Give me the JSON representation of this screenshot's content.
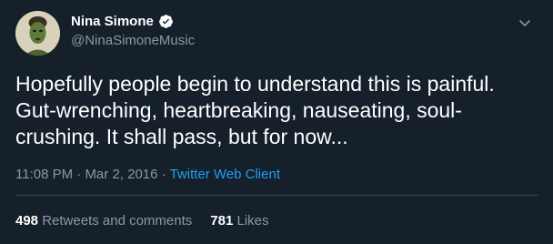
{
  "user": {
    "display_name": "Nina Simone",
    "handle": "@NinaSimoneMusic",
    "verified": true
  },
  "tweet": {
    "text": "Hopefully people begin to understand this is painful.\nGut-wrenching, heartbreaking, nauseating, soul-\ncrushing. It shall pass, but for now...",
    "time": "11:08 PM",
    "date": "Mar 2, 2016",
    "separator": "·",
    "client": "Twitter Web Client"
  },
  "stats": {
    "retweets_count": "498",
    "retweets_label": "Retweets and comments",
    "likes_count": "781",
    "likes_label": "Likes"
  },
  "icons": {
    "verified": "verified-badge-icon",
    "menu": "chevron-down-icon"
  },
  "colors": {
    "background": "#15202b",
    "text_primary": "#ffffff",
    "text_secondary": "#8899a6",
    "accent": "#1da1f2",
    "divider": "#38444d"
  }
}
